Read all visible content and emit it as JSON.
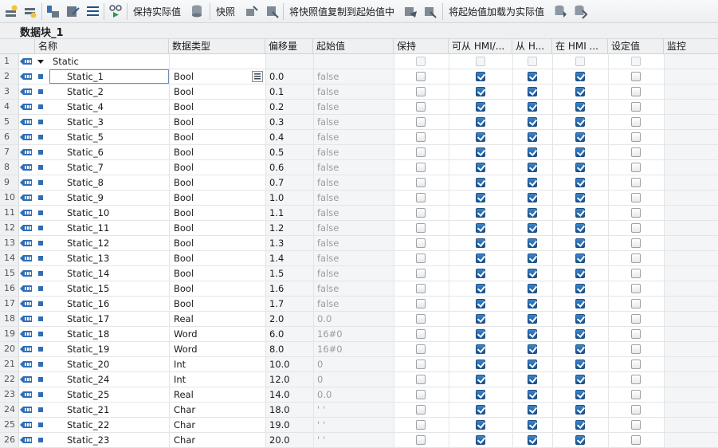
{
  "toolbar": {
    "keep_actual_label": "保持实际值",
    "snapshot_label": "快照",
    "copy_snapshot_label": "将快照值复制到起始值中",
    "load_start_label": "将起始值加载为实际值"
  },
  "block_title": "数据块_1",
  "columns": {
    "name": "名称",
    "datatype": "数据类型",
    "offset": "偏移量",
    "start_value": "起始值",
    "retain": "保持",
    "accessible_hmi": "可从 HMI/...",
    "from_hmi": "从 H...",
    "in_hmi": "在 HMI ...",
    "setpoint": "设定值",
    "monitor": "监控"
  },
  "colors": {
    "accent": "#1e5a96",
    "checkbox_on": "#2a6db3",
    "header_bg": "#eef0f2"
  },
  "icons": [
    "db-interface-icon",
    "variable-dot-icon",
    "expand-triangle-icon",
    "dropdown-list-icon"
  ],
  "rows": [
    {
      "num": "1",
      "name": "Static",
      "type": "",
      "offset": "",
      "start": "",
      "retain": false,
      "acc": false,
      "from": false,
      "in": false,
      "set": false,
      "group": true
    },
    {
      "num": "2",
      "name": "Static_1",
      "type": "Bool",
      "offset": "0.0",
      "start": "false",
      "retain": false,
      "acc": true,
      "from": true,
      "in": true,
      "set": false
    },
    {
      "num": "3",
      "name": "Static_2",
      "type": "Bool",
      "offset": "0.1",
      "start": "false",
      "retain": false,
      "acc": true,
      "from": true,
      "in": true,
      "set": false
    },
    {
      "num": "4",
      "name": "Static_4",
      "type": "Bool",
      "offset": "0.2",
      "start": "false",
      "retain": false,
      "acc": true,
      "from": true,
      "in": true,
      "set": false
    },
    {
      "num": "5",
      "name": "Static_3",
      "type": "Bool",
      "offset": "0.3",
      "start": "false",
      "retain": false,
      "acc": true,
      "from": true,
      "in": true,
      "set": false
    },
    {
      "num": "6",
      "name": "Static_5",
      "type": "Bool",
      "offset": "0.4",
      "start": "false",
      "retain": false,
      "acc": true,
      "from": true,
      "in": true,
      "set": false
    },
    {
      "num": "7",
      "name": "Static_6",
      "type": "Bool",
      "offset": "0.5",
      "start": "false",
      "retain": false,
      "acc": true,
      "from": true,
      "in": true,
      "set": false
    },
    {
      "num": "8",
      "name": "Static_7",
      "type": "Bool",
      "offset": "0.6",
      "start": "false",
      "retain": false,
      "acc": true,
      "from": true,
      "in": true,
      "set": false
    },
    {
      "num": "9",
      "name": "Static_8",
      "type": "Bool",
      "offset": "0.7",
      "start": "false",
      "retain": false,
      "acc": true,
      "from": true,
      "in": true,
      "set": false
    },
    {
      "num": "10",
      "name": "Static_9",
      "type": "Bool",
      "offset": "1.0",
      "start": "false",
      "retain": false,
      "acc": true,
      "from": true,
      "in": true,
      "set": false
    },
    {
      "num": "11",
      "name": "Static_10",
      "type": "Bool",
      "offset": "1.1",
      "start": "false",
      "retain": false,
      "acc": true,
      "from": true,
      "in": true,
      "set": false
    },
    {
      "num": "12",
      "name": "Static_11",
      "type": "Bool",
      "offset": "1.2",
      "start": "false",
      "retain": false,
      "acc": true,
      "from": true,
      "in": true,
      "set": false
    },
    {
      "num": "13",
      "name": "Static_12",
      "type": "Bool",
      "offset": "1.3",
      "start": "false",
      "retain": false,
      "acc": true,
      "from": true,
      "in": true,
      "set": false
    },
    {
      "num": "14",
      "name": "Static_13",
      "type": "Bool",
      "offset": "1.4",
      "start": "false",
      "retain": false,
      "acc": true,
      "from": true,
      "in": true,
      "set": false
    },
    {
      "num": "15",
      "name": "Static_14",
      "type": "Bool",
      "offset": "1.5",
      "start": "false",
      "retain": false,
      "acc": true,
      "from": true,
      "in": true,
      "set": false
    },
    {
      "num": "16",
      "name": "Static_15",
      "type": "Bool",
      "offset": "1.6",
      "start": "false",
      "retain": false,
      "acc": true,
      "from": true,
      "in": true,
      "set": false
    },
    {
      "num": "17",
      "name": "Static_16",
      "type": "Bool",
      "offset": "1.7",
      "start": "false",
      "retain": false,
      "acc": true,
      "from": true,
      "in": true,
      "set": false
    },
    {
      "num": "18",
      "name": "Static_17",
      "type": "Real",
      "offset": "2.0",
      "start": "0.0",
      "retain": false,
      "acc": true,
      "from": true,
      "in": true,
      "set": false
    },
    {
      "num": "19",
      "name": "Static_18",
      "type": "Word",
      "offset": "6.0",
      "start": "16#0",
      "retain": false,
      "acc": true,
      "from": true,
      "in": true,
      "set": false
    },
    {
      "num": "20",
      "name": "Static_19",
      "type": "Word",
      "offset": "8.0",
      "start": "16#0",
      "retain": false,
      "acc": true,
      "from": true,
      "in": true,
      "set": false
    },
    {
      "num": "21",
      "name": "Static_20",
      "type": "Int",
      "offset": "10.0",
      "start": "0",
      "retain": false,
      "acc": true,
      "from": true,
      "in": true,
      "set": false
    },
    {
      "num": "22",
      "name": "Static_24",
      "type": "Int",
      "offset": "12.0",
      "start": "0",
      "retain": false,
      "acc": true,
      "from": true,
      "in": true,
      "set": false
    },
    {
      "num": "23",
      "name": "Static_25",
      "type": "Real",
      "offset": "14.0",
      "start": "0.0",
      "retain": false,
      "acc": true,
      "from": true,
      "in": true,
      "set": false
    },
    {
      "num": "24",
      "name": "Static_21",
      "type": "Char",
      "offset": "18.0",
      "start": "' '",
      "retain": false,
      "acc": true,
      "from": true,
      "in": true,
      "set": false
    },
    {
      "num": "25",
      "name": "Static_22",
      "type": "Char",
      "offset": "19.0",
      "start": "' '",
      "retain": false,
      "acc": true,
      "from": true,
      "in": true,
      "set": false
    },
    {
      "num": "26",
      "name": "Static_23",
      "type": "Char",
      "offset": "20.0",
      "start": "' '",
      "retain": false,
      "acc": true,
      "from": true,
      "in": true,
      "set": false
    }
  ]
}
